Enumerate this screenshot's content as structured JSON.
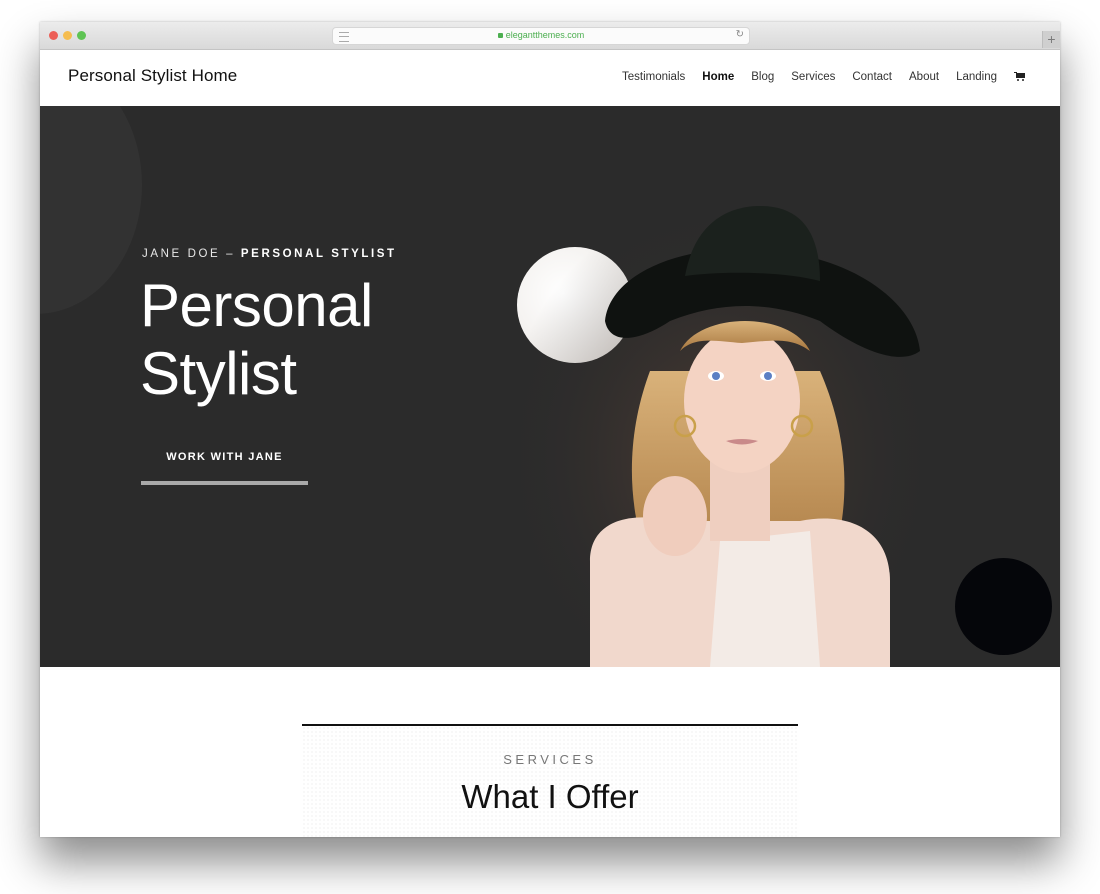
{
  "browser": {
    "url": "elegantthemes.com",
    "new_tab_label": "+"
  },
  "header": {
    "logo": "Personal Stylist Home",
    "nav": [
      {
        "label": "Testimonials",
        "active": false
      },
      {
        "label": "Home",
        "active": true
      },
      {
        "label": "Blog",
        "active": false
      },
      {
        "label": "Services",
        "active": false
      },
      {
        "label": "Contact",
        "active": false
      },
      {
        "label": "About",
        "active": false
      },
      {
        "label": "Landing",
        "active": false
      }
    ],
    "cart_icon": "shopping-cart-icon"
  },
  "hero": {
    "eyebrow_name": "JANE DOE –",
    "eyebrow_role": "PERSONAL STYLIST",
    "title_line1": "Personal",
    "title_line2": "Stylist",
    "cta_label": "WORK WITH JANE",
    "photo_alt": "Portrait of woman with curly blonde hair wearing a black hat",
    "colors": {
      "background": "#2b2b2b",
      "accent_circle_light": "#f2efec",
      "accent_circle_dark": "#05060a"
    }
  },
  "services": {
    "eyebrow": "SERVICES",
    "title": "What I Offer"
  }
}
